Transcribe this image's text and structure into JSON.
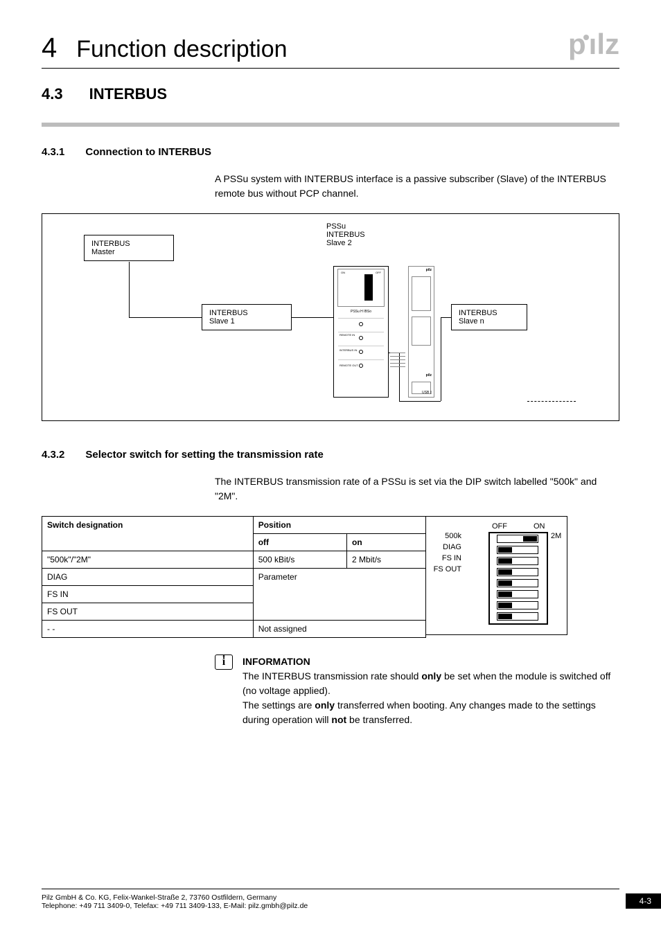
{
  "header": {
    "chapter_number": "4",
    "chapter_title": "Function description",
    "logo_text": "pilz"
  },
  "section": {
    "number": "4.3",
    "title": "INTERBUS"
  },
  "subsection1": {
    "number": "4.3.1",
    "title": "Connection to INTERBUS",
    "paragraph": "A PSSu system with INTERBUS interface is a passive subscriber (Slave) of the INTERBUS remote bus without PCP channel."
  },
  "diagram": {
    "master_label": "INTERBUS\nMaster",
    "slave1_label": "INTERBUS\nSlave 1",
    "slave2_label": "PSSu\nINTERBUS\nSlave 2",
    "slaven_label": "INTERBUS\nSlave n",
    "module_name": "PSSu H IBSo",
    "port_remote_in": "REMOTE IN",
    "port_interbus_in": "INTERBUS IN",
    "port_remote_out": "REMOTE OUT",
    "usb": "USB",
    "dip_on": "ON",
    "dip_off": "OFF"
  },
  "subsection2": {
    "number": "4.3.2",
    "title": "Selector switch for setting the transmission rate",
    "paragraph": "The INTERBUS transmission rate of a PSSu is set via the DIP switch labelled \"500k\" and \"2M\"."
  },
  "table": {
    "h_switch": "Switch designation",
    "h_position": "Position",
    "h_off": "off",
    "h_on": "on",
    "row1_name": "\"500k\"/\"2M\"",
    "row1_off": "500 kBit/s",
    "row1_on": "2 Mbit/s",
    "row2_name": "DIAG",
    "row2_val": "Parameter",
    "row3_name": "FS IN",
    "row4_name": "FS OUT",
    "row5_name": "- -",
    "row5_val": "Not assigned"
  },
  "dip_diagram": {
    "off": "OFF",
    "on": "ON",
    "l500k": "500k",
    "l2m": "2M",
    "ldiag": "DIAG",
    "lfsin": "FS IN",
    "lfsout": "FS OUT"
  },
  "info": {
    "title": "INFORMATION",
    "line1a": "The INTERBUS transmission rate should ",
    "line1b": "only",
    "line1c": " be set when the module is switched off (no voltage applied).",
    "line2a": "The settings are ",
    "line2b": "only",
    "line2c": " transferred when booting. Any changes made to the settings during operation will ",
    "line2d": "not",
    "line2e": " be transferred."
  },
  "footer": {
    "addr": "Pilz GmbH & Co. KG, Felix-Wankel-Straße 2, 73760 Ostfildern, Germany",
    "contact": "Telephone: +49 711 3409-0, Telefax: +49 711 3409-133, E-Mail: pilz.gmbh@pilz.de",
    "page": "4-3"
  }
}
